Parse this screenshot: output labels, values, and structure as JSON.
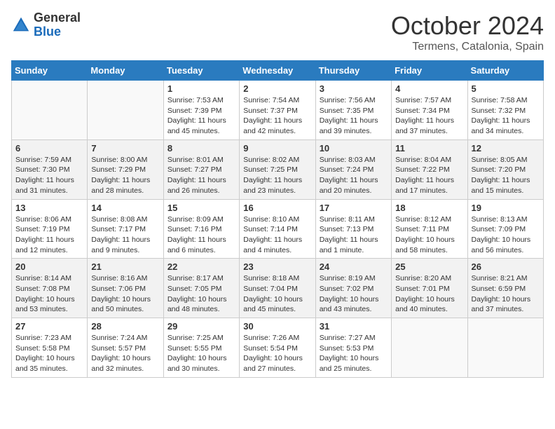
{
  "header": {
    "logo_general": "General",
    "logo_blue": "Blue",
    "month_title": "October 2024",
    "location": "Termens, Catalonia, Spain"
  },
  "calendar": {
    "days_of_week": [
      "Sunday",
      "Monday",
      "Tuesday",
      "Wednesday",
      "Thursday",
      "Friday",
      "Saturday"
    ],
    "weeks": [
      [
        {
          "day": "",
          "info": ""
        },
        {
          "day": "",
          "info": ""
        },
        {
          "day": "1",
          "info": "Sunrise: 7:53 AM\nSunset: 7:39 PM\nDaylight: 11 hours and 45 minutes."
        },
        {
          "day": "2",
          "info": "Sunrise: 7:54 AM\nSunset: 7:37 PM\nDaylight: 11 hours and 42 minutes."
        },
        {
          "day": "3",
          "info": "Sunrise: 7:56 AM\nSunset: 7:35 PM\nDaylight: 11 hours and 39 minutes."
        },
        {
          "day": "4",
          "info": "Sunrise: 7:57 AM\nSunset: 7:34 PM\nDaylight: 11 hours and 37 minutes."
        },
        {
          "day": "5",
          "info": "Sunrise: 7:58 AM\nSunset: 7:32 PM\nDaylight: 11 hours and 34 minutes."
        }
      ],
      [
        {
          "day": "6",
          "info": "Sunrise: 7:59 AM\nSunset: 7:30 PM\nDaylight: 11 hours and 31 minutes."
        },
        {
          "day": "7",
          "info": "Sunrise: 8:00 AM\nSunset: 7:29 PM\nDaylight: 11 hours and 28 minutes."
        },
        {
          "day": "8",
          "info": "Sunrise: 8:01 AM\nSunset: 7:27 PM\nDaylight: 11 hours and 26 minutes."
        },
        {
          "day": "9",
          "info": "Sunrise: 8:02 AM\nSunset: 7:25 PM\nDaylight: 11 hours and 23 minutes."
        },
        {
          "day": "10",
          "info": "Sunrise: 8:03 AM\nSunset: 7:24 PM\nDaylight: 11 hours and 20 minutes."
        },
        {
          "day": "11",
          "info": "Sunrise: 8:04 AM\nSunset: 7:22 PM\nDaylight: 11 hours and 17 minutes."
        },
        {
          "day": "12",
          "info": "Sunrise: 8:05 AM\nSunset: 7:20 PM\nDaylight: 11 hours and 15 minutes."
        }
      ],
      [
        {
          "day": "13",
          "info": "Sunrise: 8:06 AM\nSunset: 7:19 PM\nDaylight: 11 hours and 12 minutes."
        },
        {
          "day": "14",
          "info": "Sunrise: 8:08 AM\nSunset: 7:17 PM\nDaylight: 11 hours and 9 minutes."
        },
        {
          "day": "15",
          "info": "Sunrise: 8:09 AM\nSunset: 7:16 PM\nDaylight: 11 hours and 6 minutes."
        },
        {
          "day": "16",
          "info": "Sunrise: 8:10 AM\nSunset: 7:14 PM\nDaylight: 11 hours and 4 minutes."
        },
        {
          "day": "17",
          "info": "Sunrise: 8:11 AM\nSunset: 7:13 PM\nDaylight: 11 hours and 1 minute."
        },
        {
          "day": "18",
          "info": "Sunrise: 8:12 AM\nSunset: 7:11 PM\nDaylight: 10 hours and 58 minutes."
        },
        {
          "day": "19",
          "info": "Sunrise: 8:13 AM\nSunset: 7:09 PM\nDaylight: 10 hours and 56 minutes."
        }
      ],
      [
        {
          "day": "20",
          "info": "Sunrise: 8:14 AM\nSunset: 7:08 PM\nDaylight: 10 hours and 53 minutes."
        },
        {
          "day": "21",
          "info": "Sunrise: 8:16 AM\nSunset: 7:06 PM\nDaylight: 10 hours and 50 minutes."
        },
        {
          "day": "22",
          "info": "Sunrise: 8:17 AM\nSunset: 7:05 PM\nDaylight: 10 hours and 48 minutes."
        },
        {
          "day": "23",
          "info": "Sunrise: 8:18 AM\nSunset: 7:04 PM\nDaylight: 10 hours and 45 minutes."
        },
        {
          "day": "24",
          "info": "Sunrise: 8:19 AM\nSunset: 7:02 PM\nDaylight: 10 hours and 43 minutes."
        },
        {
          "day": "25",
          "info": "Sunrise: 8:20 AM\nSunset: 7:01 PM\nDaylight: 10 hours and 40 minutes."
        },
        {
          "day": "26",
          "info": "Sunrise: 8:21 AM\nSunset: 6:59 PM\nDaylight: 10 hours and 37 minutes."
        }
      ],
      [
        {
          "day": "27",
          "info": "Sunrise: 7:23 AM\nSunset: 5:58 PM\nDaylight: 10 hours and 35 minutes."
        },
        {
          "day": "28",
          "info": "Sunrise: 7:24 AM\nSunset: 5:57 PM\nDaylight: 10 hours and 32 minutes."
        },
        {
          "day": "29",
          "info": "Sunrise: 7:25 AM\nSunset: 5:55 PM\nDaylight: 10 hours and 30 minutes."
        },
        {
          "day": "30",
          "info": "Sunrise: 7:26 AM\nSunset: 5:54 PM\nDaylight: 10 hours and 27 minutes."
        },
        {
          "day": "31",
          "info": "Sunrise: 7:27 AM\nSunset: 5:53 PM\nDaylight: 10 hours and 25 minutes."
        },
        {
          "day": "",
          "info": ""
        },
        {
          "day": "",
          "info": ""
        }
      ]
    ]
  }
}
